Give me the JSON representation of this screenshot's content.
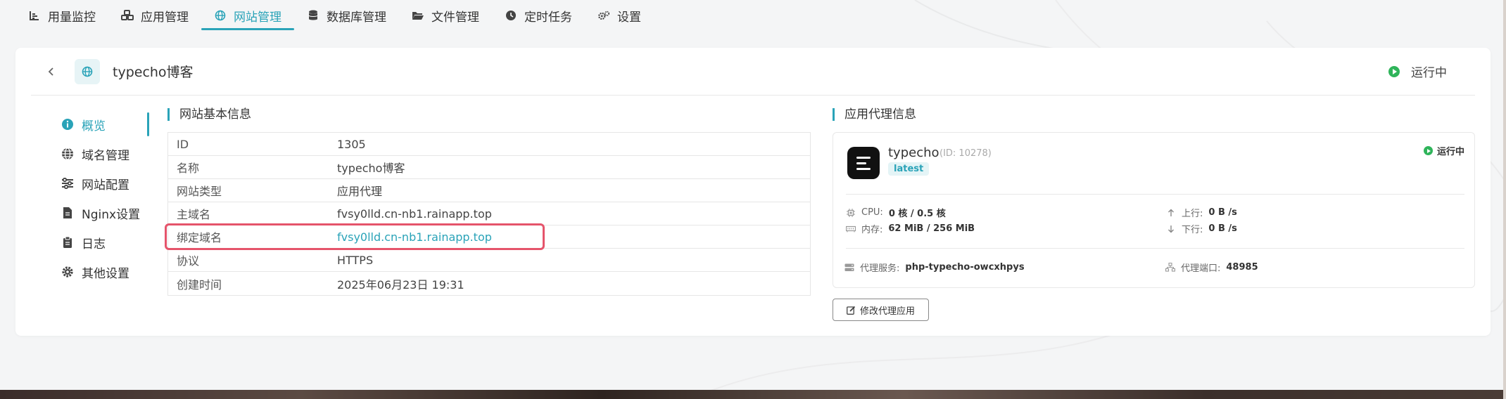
{
  "topnav": {
    "items": [
      {
        "label": "用量监控",
        "icon": "chart-line-icon"
      },
      {
        "label": "应用管理",
        "icon": "cubes-icon"
      },
      {
        "label": "网站管理",
        "icon": "globe-icon",
        "active": true
      },
      {
        "label": "数据库管理",
        "icon": "database-icon"
      },
      {
        "label": "文件管理",
        "icon": "folder-open-icon"
      },
      {
        "label": "定时任务",
        "icon": "clock-icon"
      },
      {
        "label": "设置",
        "icon": "gears-icon"
      }
    ]
  },
  "header": {
    "title": "typecho博客",
    "status": "运行中"
  },
  "side": {
    "items": [
      {
        "label": "概览",
        "icon": "info-circle-icon",
        "active": true
      },
      {
        "label": "域名管理",
        "icon": "globe-icon"
      },
      {
        "label": "网站配置",
        "icon": "sliders-icon"
      },
      {
        "label": "Nginx设置",
        "icon": "file-icon"
      },
      {
        "label": "日志",
        "icon": "clipboard-icon"
      },
      {
        "label": "其他设置",
        "icon": "gear-icon"
      }
    ]
  },
  "basic": {
    "title": "网站基本信息",
    "rows": [
      {
        "key": "ID",
        "value": "1305"
      },
      {
        "key": "名称",
        "value": "typecho博客"
      },
      {
        "key": "网站类型",
        "value": "应用代理"
      },
      {
        "key": "主域名",
        "value": "fvsy0lld.cn-nb1.rainapp.top"
      },
      {
        "key": "绑定域名",
        "value": "fvsy0lld.cn-nb1.rainapp.top",
        "link": true
      },
      {
        "key": "协议",
        "value": "HTTPS"
      },
      {
        "key": "创建时间",
        "value": "2025年06月23日 19:31"
      }
    ]
  },
  "proxy": {
    "title": "应用代理信息",
    "app_name": "typecho",
    "app_id": "(ID: 10278)",
    "tag": "latest",
    "status": "运行中",
    "cpu_label": "CPU:",
    "cpu_value": "0 核 / 0.5 核",
    "mem_label": "内存:",
    "mem_value": "62 MiB / 256 MiB",
    "up_label": "上行:",
    "up_value": "0 B /s",
    "down_label": "下行:",
    "down_value": "0 B /s",
    "service_label": "代理服务:",
    "service_value": "php-typecho-owcxhpys",
    "port_label": "代理端口:",
    "port_value": "48985",
    "edit_label": "修改代理应用"
  },
  "colors": {
    "accent": "#2aa3b8",
    "running": "#2fb45a",
    "highlight": "#e5546b"
  }
}
